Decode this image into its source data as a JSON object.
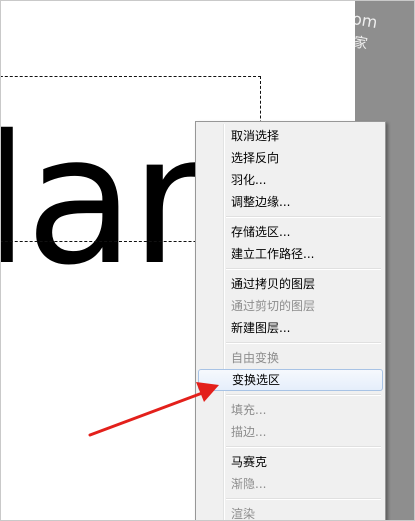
{
  "watermark": {
    "text": "jia.com",
    "char": "家"
  },
  "canvas": {
    "text": "lar"
  },
  "context_menu": {
    "highlighted": "变换选区",
    "groups": [
      [
        {
          "label": "取消选择",
          "enabled": true
        },
        {
          "label": "选择反向",
          "enabled": true
        },
        {
          "label": "羽化...",
          "enabled": true
        },
        {
          "label": "调整边缘...",
          "enabled": true
        }
      ],
      [
        {
          "label": "存储选区...",
          "enabled": true
        },
        {
          "label": "建立工作路径...",
          "enabled": true
        }
      ],
      [
        {
          "label": "通过拷贝的图层",
          "enabled": true
        },
        {
          "label": "通过剪切的图层",
          "enabled": false
        },
        {
          "label": "新建图层...",
          "enabled": true
        }
      ],
      [
        {
          "label": "自由变换",
          "enabled": false
        },
        {
          "label": "变换选区",
          "enabled": true
        }
      ],
      [
        {
          "label": "填充...",
          "enabled": false
        },
        {
          "label": "描边...",
          "enabled": false
        }
      ],
      [
        {
          "label": "马赛克",
          "enabled": true
        },
        {
          "label": "渐隐...",
          "enabled": false
        }
      ],
      [
        {
          "label": "渲染",
          "enabled": false
        }
      ]
    ]
  },
  "colors": {
    "arrow": "#e3201b",
    "workspace": "#8e8e8e",
    "menu_bg": "#f0f0f0",
    "highlight_border": "#a8c3e5"
  }
}
